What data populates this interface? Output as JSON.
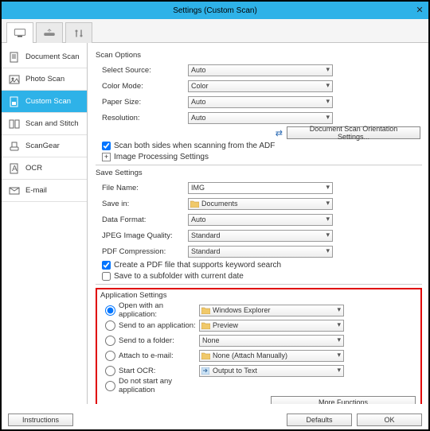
{
  "title": "Settings (Custom Scan)",
  "sidebar": {
    "items": [
      {
        "label": "Document Scan"
      },
      {
        "label": "Photo Scan"
      },
      {
        "label": "Custom Scan"
      },
      {
        "label": "Scan and Stitch"
      },
      {
        "label": "ScanGear"
      },
      {
        "label": "OCR"
      },
      {
        "label": "E-mail"
      }
    ]
  },
  "scan_options": {
    "title": "Scan Options",
    "select_source": {
      "label": "Select Source:",
      "value": "Auto"
    },
    "color_mode": {
      "label": "Color Mode:",
      "value": "Color"
    },
    "paper_size": {
      "label": "Paper Size:",
      "value": "Auto"
    },
    "resolution": {
      "label": "Resolution:",
      "value": "Auto"
    },
    "orientation_btn": "Document Scan Orientation Settings...",
    "scan_both": "Scan both sides when scanning from the ADF",
    "img_proc": "Image Processing Settings"
  },
  "save_settings": {
    "title": "Save Settings",
    "file_name": {
      "label": "File Name:",
      "value": "IMG"
    },
    "save_in": {
      "label": "Save in:",
      "value": "Documents"
    },
    "data_format": {
      "label": "Data Format:",
      "value": "Auto"
    },
    "jpeg": {
      "label": "JPEG Image Quality:",
      "value": "Standard"
    },
    "pdf": {
      "label": "PDF Compression:",
      "value": "Standard"
    },
    "create_pdf": "Create a PDF file that supports keyword search",
    "subfolder": "Save to a subfolder with current date"
  },
  "app_settings": {
    "title": "Application Settings",
    "open_app": {
      "label": "Open with an application:",
      "value": "Windows Explorer"
    },
    "send_app": {
      "label": "Send to an application:",
      "value": "Preview"
    },
    "send_folder": {
      "label": "Send to a folder:",
      "value": "None"
    },
    "attach": {
      "label": "Attach to e-mail:",
      "value": "None (Attach Manually)"
    },
    "ocr": {
      "label": "Start OCR:",
      "value": "Output to Text"
    },
    "none": "Do not start any application",
    "more": "More Functions"
  },
  "footer": {
    "instructions": "Instructions",
    "defaults": "Defaults",
    "ok": "OK"
  }
}
